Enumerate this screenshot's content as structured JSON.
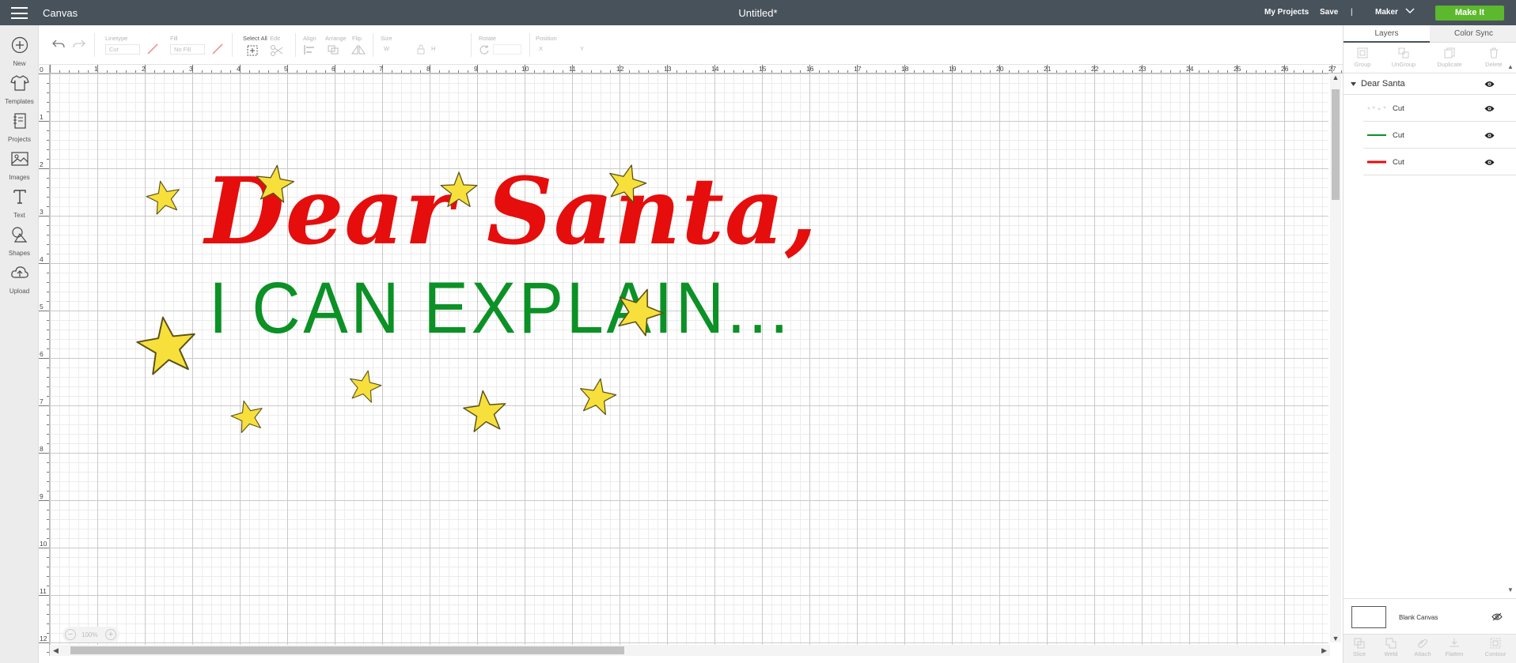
{
  "app": {
    "name": "Canvas",
    "document_title": "Untitled*",
    "my_projects": "My Projects",
    "save": "Save",
    "separator": "|",
    "machine": "Maker",
    "make_it": "Make It",
    "accent_color": "#5cb82d",
    "topbar_color": "#48525b"
  },
  "left_nav": [
    {
      "label": "New",
      "icon": "plus-circle-icon"
    },
    {
      "label": "Templates",
      "icon": "tshirt-icon"
    },
    {
      "label": "Projects",
      "icon": "notebook-icon"
    },
    {
      "label": "Images",
      "icon": "image-icon"
    },
    {
      "label": "Text",
      "icon": "text-icon"
    },
    {
      "label": "Shapes",
      "icon": "shapes-icon"
    },
    {
      "label": "Upload",
      "icon": "cloud-upload-icon"
    }
  ],
  "toolbar": {
    "linetype_label": "Linetype",
    "linetype_value": "Cut",
    "fill_label": "Fill",
    "fill_value": "No Fill",
    "select_all": "Select All",
    "edit": "Edit",
    "align": "Align",
    "arrange": "Arrange",
    "flip": "Flip",
    "size": "Size",
    "size_w": "W",
    "size_h": "H",
    "rotate": "Rotate",
    "position": "Position",
    "pos_x": "X",
    "pos_y": "Y"
  },
  "rulers": {
    "horizontal": [
      "0",
      "1",
      "2",
      "3",
      "4",
      "5",
      "6",
      "7",
      "8",
      "9",
      "10",
      "11",
      "12",
      "13",
      "14",
      "15",
      "16",
      "17",
      "18",
      "19",
      "20",
      "21",
      "22",
      "23",
      "24",
      "25",
      "26",
      "27"
    ],
    "vertical": [
      "0",
      "1",
      "2",
      "3",
      "4",
      "5",
      "6",
      "7",
      "8",
      "9",
      "10",
      "11",
      "12"
    ]
  },
  "zoom": {
    "value": "100%",
    "minus": "−",
    "plus": "+"
  },
  "design": {
    "line1": "Dear Santa,",
    "line2": "I CAN EXPLAIN...",
    "line1_color": "#e60d0d",
    "line2_color": "#0c9126",
    "star_color": "#f7e03b"
  },
  "layers_panel": {
    "tabs": [
      "Layers",
      "Color Sync"
    ],
    "actions": [
      "Group",
      "UnGroup",
      "Duplicate",
      "Delete"
    ],
    "group_name": "Dear Santa",
    "layers": [
      {
        "name": "Cut",
        "thumb": "stars"
      },
      {
        "name": "Cut",
        "thumb": "green-text"
      },
      {
        "name": "Cut",
        "thumb": "red-text"
      }
    ],
    "blank_canvas": "Blank Canvas",
    "bottom_actions": [
      "Slice",
      "Weld",
      "Attach",
      "Flatten",
      "Contour"
    ]
  }
}
